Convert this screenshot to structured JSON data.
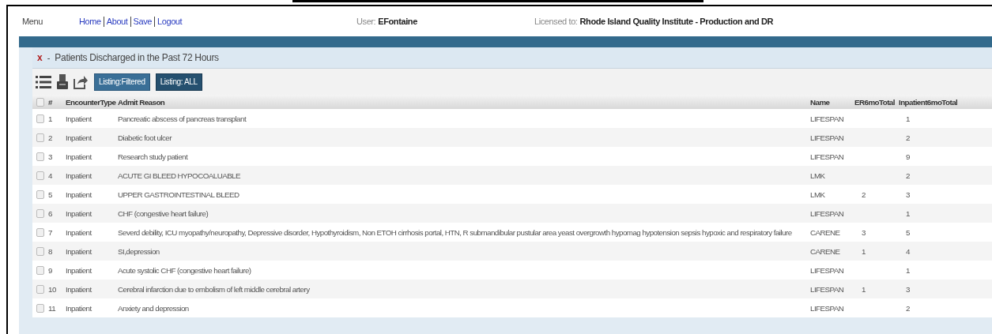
{
  "top_bar": {
    "menu": "Menu",
    "links": [
      "Home",
      "About",
      "Save",
      "Logout"
    ],
    "user_label": "User:",
    "user": "EFontaine",
    "license_label": "Licensed to:",
    "license": "Rhode Island Quality Institute - Production and DR"
  },
  "panel": {
    "close": "x",
    "collapse": "-",
    "title": "Patients Discharged in the Past 72 Hours"
  },
  "toolbar": {
    "buttons": [
      {
        "label": "Listing:Filtered",
        "selected": false
      },
      {
        "label": "Listing: ALL",
        "selected": true
      }
    ]
  },
  "table": {
    "header_checked": false,
    "columns": [
      "#",
      "EncounterType",
      "Admit Reason",
      "Name",
      "ER6moTotal",
      "Inpatient6moTotal"
    ],
    "rows": [
      {
        "checked": false,
        "cells": [
          "1",
          "Inpatient",
          "Pancreatic abscess of pancreas transplant",
          "LIFESPAN",
          "",
          "1"
        ]
      },
      {
        "checked": false,
        "cells": [
          "2",
          "Inpatient",
          "Diabetic foot ulcer",
          "LIFESPAN",
          "",
          "2"
        ]
      },
      {
        "checked": false,
        "cells": [
          "3",
          "Inpatient",
          "Research study patient",
          "LIFESPAN",
          "",
          "9"
        ]
      },
      {
        "checked": false,
        "cells": [
          "4",
          "Inpatient",
          "ACUTE GI BLEED HYPOCOALUABLE",
          "LMK",
          "",
          "2"
        ]
      },
      {
        "checked": false,
        "cells": [
          "5",
          "Inpatient",
          "UPPER GASTROINTESTINAL BLEED",
          "LMK",
          "2",
          "3"
        ]
      },
      {
        "checked": false,
        "cells": [
          "6",
          "Inpatient",
          "CHF (congestive heart failure)",
          "LIFESPAN",
          "",
          "1"
        ]
      },
      {
        "checked": false,
        "cells": [
          "7",
          "Inpatient",
          "Severd debility, ICU myopathy/neuropathy, Depressive disorder, Hypothyroidism, Non ETOH cirrhosis portal, HTN, R submandibular pustular area yeast overgrowth hypomag hypotension sepsis hypoxic and respiratory failure",
          "CARENE",
          "3",
          "5"
        ]
      },
      {
        "checked": false,
        "cells": [
          "8",
          "Inpatient",
          "SI,depression",
          "CARENE",
          "1",
          "4"
        ]
      },
      {
        "checked": false,
        "cells": [
          "9",
          "Inpatient",
          "Acute systolic CHF (congestive heart failure)",
          "LIFESPAN",
          "",
          "1"
        ]
      },
      {
        "checked": false,
        "cells": [
          "10",
          "Inpatient",
          "Cerebral infarction due to embolism of left middle cerebral artery",
          "LIFESPAN",
          "1",
          "3"
        ]
      },
      {
        "checked": false,
        "cells": [
          "11",
          "Inpatient",
          "Anxiety and depression",
          "LIFESPAN",
          "",
          "2"
        ]
      }
    ]
  }
}
